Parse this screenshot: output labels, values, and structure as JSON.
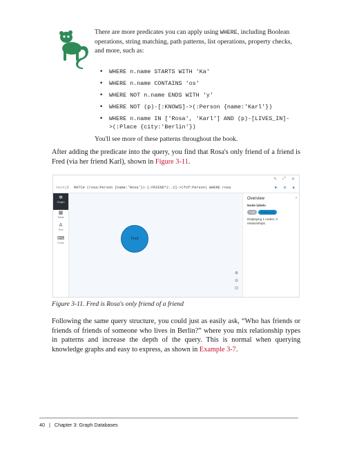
{
  "note": {
    "intro_pre": "There are more predicates you can apply using ",
    "intro_code": "WHERE",
    "intro_post": ", including Boolean operations, string matching, path patterns, list operations, property checks, and more, such as:",
    "examples": [
      "WHERE n.name STARTS WITH 'Ka'",
      "WHERE n.name CONTAINS 'os'",
      "WHERE NOT n.name ENDS WITH 'y'",
      "WHERE NOT (p)-[:KNOWS]->(:Person {name:'Karl'})",
      "WHERE n.name IN ['Rosa', 'Karl'] AND (p)-[LIVES_IN]-",
      ">(:Place {city:'Berlin'})"
    ],
    "closing": "You'll see more of these patterns throughout the book."
  },
  "para1": {
    "pre": "After adding the predicate into the query, you find that Rosa's only friend of a friend is Fred (via her friend Karl), shown in ",
    "ref": "Figure 3-11",
    "post": "."
  },
  "screenshot": {
    "prompt": "neo4j$",
    "query": "MATCH (rosa:Person {name:'Rosa'})-[:FRIEND*2..2]->(fof:Person) WHERE rosa <> fof RETUR…",
    "sidebar": [
      {
        "icon": "graph-icon",
        "glyph": "✲",
        "label": "Graph"
      },
      {
        "icon": "table-icon",
        "glyph": "▦",
        "label": "Table"
      },
      {
        "icon": "text-icon",
        "glyph": "A",
        "label": "Text"
      },
      {
        "icon": "code-icon",
        "glyph": "⌨",
        "label": "Code"
      }
    ],
    "node_label": "Fred",
    "panel": {
      "title": "Overview",
      "node_labels_heading": "Node labels",
      "pill_all": "* (1)",
      "pill_person": "Person (1)",
      "status": "Displaying 1 nodes, 0 relationships."
    }
  },
  "caption": "Figure 3-11. Fred is Rosa's only friend of a friend",
  "para2": {
    "pre": "Following the same query structure, you could just as easily ask, “Who has friends or friends of friends of someone who lives in Berlin?” where you mix relationship types in patterns and increase the depth of the query. This is normal when querying knowledge graphs and easy to express, as shown in ",
    "ref": "Example 3-7",
    "post": "."
  },
  "footer": {
    "page": "40",
    "separator": "|",
    "chapter": "Chapter 3: Graph Databases"
  }
}
